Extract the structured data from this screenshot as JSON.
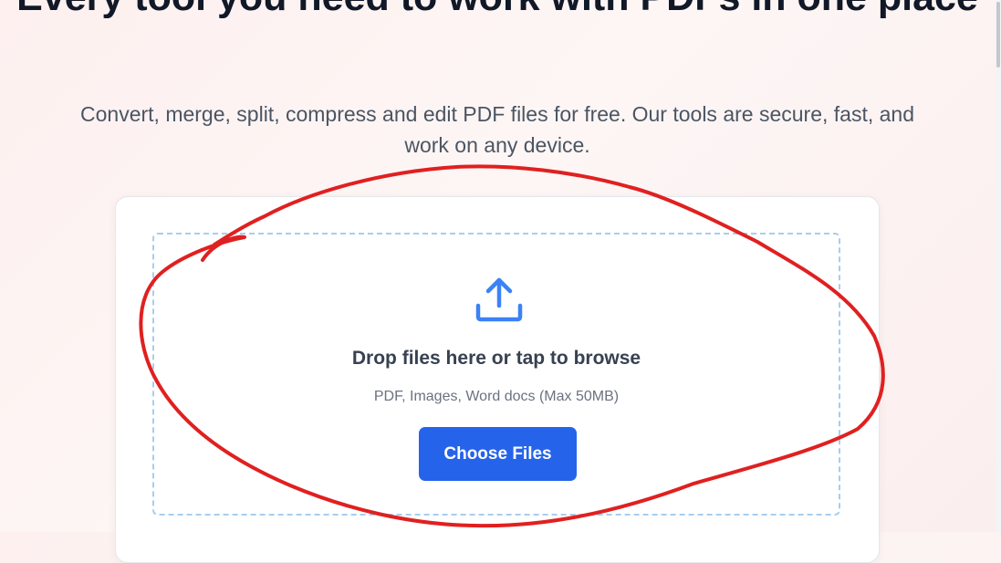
{
  "hero": {
    "title": "Every tool you need to work with PDFs in one place",
    "subtitle": "Convert, merge, split, compress and edit PDF files for free. Our tools are secure, fast, and work on any device."
  },
  "upload": {
    "icon": "upload-icon",
    "drop_title": "Drop files here or tap to browse",
    "drop_hint": "PDF, Images, Word docs (Max 50MB)",
    "button_label": "Choose Files"
  },
  "colors": {
    "accent": "#2563eb",
    "dropzone_border": "#a8cdee",
    "annotation": "#e02020"
  }
}
